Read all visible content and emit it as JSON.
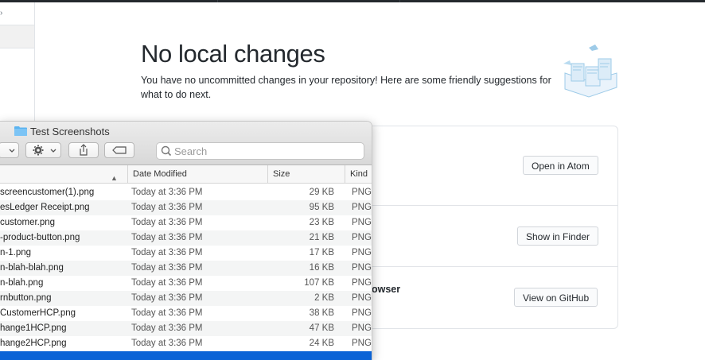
{
  "github": {
    "title": "No local changes",
    "description": "You have no uncommitted changes in your repository! Here are some friendly suggestions for what to do next.",
    "actions": [
      {
        "label": "Open in Atom"
      },
      {
        "label": "Show in Finder"
      },
      {
        "label": "View on GitHub"
      }
    ],
    "partial_text": "owser"
  },
  "finder": {
    "window_title": "Test Screenshots",
    "search_placeholder": "Search",
    "columns": {
      "date": "Date Modified",
      "size": "Size",
      "kind": "Kind"
    },
    "files": [
      {
        "name": "screencustomer(1).png",
        "date": "Today at 3:36 PM",
        "size": "29 KB",
        "kind": "PNG"
      },
      {
        "name": "esLedger Receipt.png",
        "date": "Today at 3:36 PM",
        "size": "95 KB",
        "kind": "PNG"
      },
      {
        "name": "customer.png",
        "date": "Today at 3:36 PM",
        "size": "23 KB",
        "kind": "PNG"
      },
      {
        "name": "-product-button.png",
        "date": "Today at 3:36 PM",
        "size": "21 KB",
        "kind": "PNG"
      },
      {
        "name": "n-1.png",
        "date": "Today at 3:36 PM",
        "size": "17 KB",
        "kind": "PNG"
      },
      {
        "name": "n-blah-blah.png",
        "date": "Today at 3:36 PM",
        "size": "16 KB",
        "kind": "PNG"
      },
      {
        "name": "n-blah.png",
        "date": "Today at 3:36 PM",
        "size": "107 KB",
        "kind": "PNG"
      },
      {
        "name": "rnbutton.png",
        "date": "Today at 3:36 PM",
        "size": "2 KB",
        "kind": "PNG"
      },
      {
        "name": "CustomerHCP.png",
        "date": "Today at 3:36 PM",
        "size": "38 KB",
        "kind": "PNG"
      },
      {
        "name": "hange1HCP.png",
        "date": "Today at 3:36 PM",
        "size": "47 KB",
        "kind": "PNG"
      },
      {
        "name": "hange2HCP.png",
        "date": "Today at 3:36 PM",
        "size": "24 KB",
        "kind": "PNG"
      }
    ]
  },
  "colors": {
    "selection": "#0a63d6",
    "folder": "#5ab3f0",
    "illustration": "#9ecbe8"
  },
  "icons": [
    "folder-icon",
    "gear-icon",
    "share-icon",
    "tag-icon",
    "search-icon",
    "view-toggle-icon",
    "sort-arrow-icon"
  ]
}
